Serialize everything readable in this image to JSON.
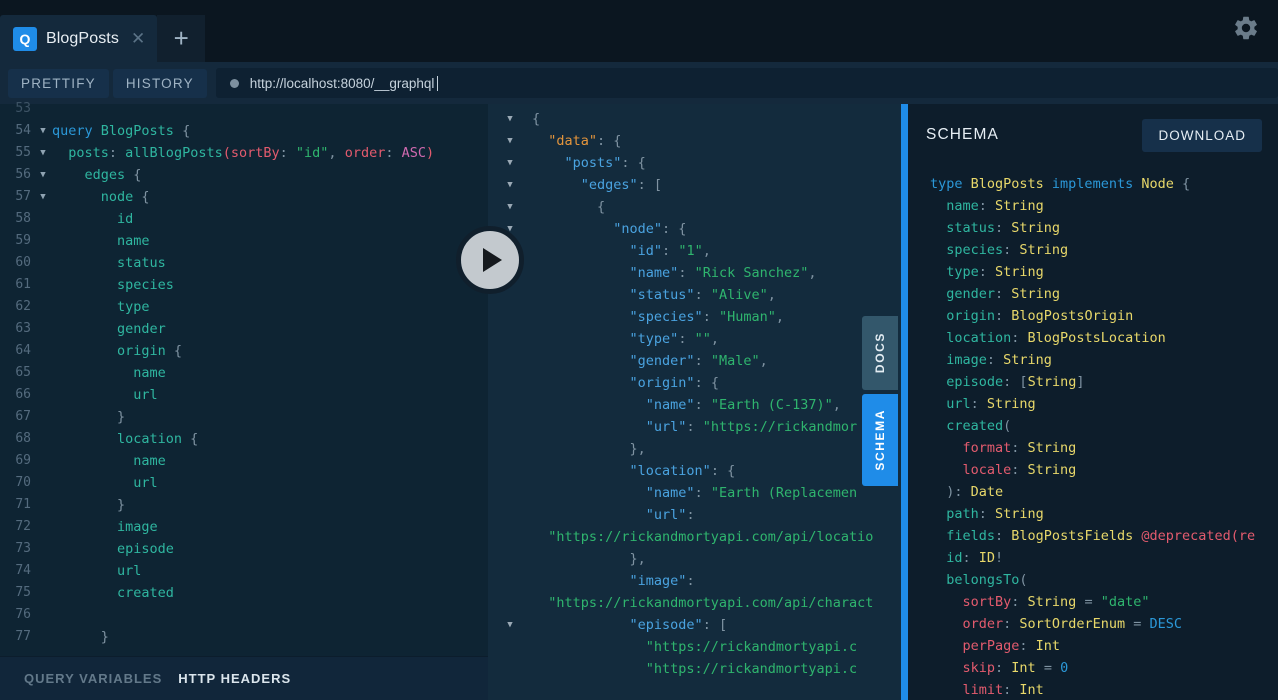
{
  "window": {
    "tab": {
      "badge": "Q",
      "title": "BlogPosts",
      "close_icon": "close-icon",
      "add_icon": "plus-icon"
    },
    "gear_icon": "gear-icon"
  },
  "toolbar": {
    "prettify": "PRETTIFY",
    "history": "HISTORY",
    "url": "http://localhost:8080/__graphql",
    "execute_icon": "play-icon"
  },
  "colors": {
    "accent_blue": "#1f8ce8",
    "editor_bg": "#0e2433",
    "response_bg": "#132b3d",
    "schema_bg": "#0d1d2b",
    "toolbar_bg": "#14293c"
  },
  "editor": {
    "first_partial_line": "53",
    "lines": [
      {
        "n": "54",
        "fold": true,
        "tokens": [
          {
            "t": "query ",
            "c": "c-kw"
          },
          {
            "t": "BlogPosts",
            "c": "c-key"
          },
          {
            "t": " {",
            "c": "c-punct"
          }
        ]
      },
      {
        "n": "55",
        "fold": true,
        "tokens": [
          {
            "t": "  posts",
            "c": "c-field"
          },
          {
            "t": ": ",
            "c": "c-punct"
          },
          {
            "t": "allBlogPosts",
            "c": "c-key"
          },
          {
            "t": "(",
            "c": "c-arg"
          },
          {
            "t": "sortBy",
            "c": "c-arg"
          },
          {
            "t": ": ",
            "c": "c-punct"
          },
          {
            "t": "\"id\"",
            "c": "c-str"
          },
          {
            "t": ", ",
            "c": "c-punct"
          },
          {
            "t": "order",
            "c": "c-arg"
          },
          {
            "t": ": ",
            "c": "c-punct"
          },
          {
            "t": "ASC",
            "c": "c-enum"
          },
          {
            "t": ")",
            "c": "c-arg"
          }
        ]
      },
      {
        "n": "56",
        "fold": true,
        "tokens": [
          {
            "t": "    edges",
            "c": "c-field"
          },
          {
            "t": " {",
            "c": "c-punct"
          }
        ]
      },
      {
        "n": "57",
        "fold": true,
        "tokens": [
          {
            "t": "      node",
            "c": "c-field"
          },
          {
            "t": " {",
            "c": "c-punct"
          }
        ]
      },
      {
        "n": "58",
        "fold": false,
        "tokens": [
          {
            "t": "        id",
            "c": "c-field"
          }
        ]
      },
      {
        "n": "59",
        "fold": false,
        "tokens": [
          {
            "t": "        name",
            "c": "c-field"
          }
        ]
      },
      {
        "n": "60",
        "fold": false,
        "tokens": [
          {
            "t": "        status",
            "c": "c-field"
          }
        ]
      },
      {
        "n": "61",
        "fold": false,
        "tokens": [
          {
            "t": "        species",
            "c": "c-field"
          }
        ]
      },
      {
        "n": "62",
        "fold": false,
        "tokens": [
          {
            "t": "        type",
            "c": "c-field"
          }
        ]
      },
      {
        "n": "63",
        "fold": false,
        "tokens": [
          {
            "t": "        gender",
            "c": "c-field"
          }
        ]
      },
      {
        "n": "64",
        "fold": false,
        "tokens": [
          {
            "t": "        origin",
            "c": "c-field"
          },
          {
            "t": " {",
            "c": "c-punct"
          }
        ]
      },
      {
        "n": "65",
        "fold": false,
        "tokens": [
          {
            "t": "          name",
            "c": "c-field"
          }
        ]
      },
      {
        "n": "66",
        "fold": false,
        "tokens": [
          {
            "t": "          url",
            "c": "c-field"
          }
        ]
      },
      {
        "n": "67",
        "fold": false,
        "tokens": [
          {
            "t": "        }",
            "c": "c-punct"
          }
        ]
      },
      {
        "n": "68",
        "fold": false,
        "tokens": [
          {
            "t": "        location",
            "c": "c-field"
          },
          {
            "t": " {",
            "c": "c-punct"
          }
        ]
      },
      {
        "n": "69",
        "fold": false,
        "tokens": [
          {
            "t": "          name",
            "c": "c-field"
          }
        ]
      },
      {
        "n": "70",
        "fold": false,
        "tokens": [
          {
            "t": "          url",
            "c": "c-field"
          }
        ]
      },
      {
        "n": "71",
        "fold": false,
        "tokens": [
          {
            "t": "        }",
            "c": "c-punct"
          }
        ]
      },
      {
        "n": "72",
        "fold": false,
        "tokens": [
          {
            "t": "        image",
            "c": "c-field"
          }
        ]
      },
      {
        "n": "73",
        "fold": false,
        "tokens": [
          {
            "t": "        episode",
            "c": "c-field"
          }
        ]
      },
      {
        "n": "74",
        "fold": false,
        "tokens": [
          {
            "t": "        url",
            "c": "c-field"
          }
        ]
      },
      {
        "n": "75",
        "fold": false,
        "tokens": [
          {
            "t": "        created",
            "c": "c-field"
          }
        ]
      },
      {
        "n": "76",
        "fold": false,
        "tokens": [
          {
            "t": "",
            "c": "c-punct"
          }
        ]
      },
      {
        "n": "77",
        "fold": false,
        "tokens": [
          {
            "t": "      }",
            "c": "c-punct"
          }
        ]
      }
    ]
  },
  "bottom_tabs": {
    "query_variables": "QUERY VARIABLES",
    "http_headers": "HTTP HEADERS",
    "active": "HTTP HEADERS"
  },
  "response": {
    "lines": [
      {
        "fold": true,
        "tokens": [
          {
            "t": "{",
            "c": "c-punct"
          }
        ]
      },
      {
        "fold": true,
        "tokens": [
          {
            "t": "  \"data\"",
            "c": "c-jdata"
          },
          {
            "t": ": {",
            "c": "c-punct"
          }
        ]
      },
      {
        "fold": true,
        "tokens": [
          {
            "t": "    \"posts\"",
            "c": "c-jkey"
          },
          {
            "t": ": {",
            "c": "c-punct"
          }
        ]
      },
      {
        "fold": true,
        "tokens": [
          {
            "t": "      \"edges\"",
            "c": "c-jkey"
          },
          {
            "t": ": [",
            "c": "c-punct"
          }
        ]
      },
      {
        "fold": true,
        "tokens": [
          {
            "t": "        {",
            "c": "c-punct"
          }
        ]
      },
      {
        "fold": true,
        "tokens": [
          {
            "t": "          \"node\"",
            "c": "c-jkey"
          },
          {
            "t": ": {",
            "c": "c-punct"
          }
        ]
      },
      {
        "fold": false,
        "tokens": [
          {
            "t": "            \"id\"",
            "c": "c-jkey"
          },
          {
            "t": ": ",
            "c": "c-punct"
          },
          {
            "t": "\"1\"",
            "c": "c-jstr"
          },
          {
            "t": ",",
            "c": "c-punct"
          }
        ]
      },
      {
        "fold": false,
        "tokens": [
          {
            "t": "            \"name\"",
            "c": "c-jkey"
          },
          {
            "t": ": ",
            "c": "c-punct"
          },
          {
            "t": "\"Rick Sanchez\"",
            "c": "c-jstr"
          },
          {
            "t": ",",
            "c": "c-punct"
          }
        ]
      },
      {
        "fold": false,
        "tokens": [
          {
            "t": "            \"status\"",
            "c": "c-jkey"
          },
          {
            "t": ": ",
            "c": "c-punct"
          },
          {
            "t": "\"Alive\"",
            "c": "c-jstr"
          },
          {
            "t": ",",
            "c": "c-punct"
          }
        ]
      },
      {
        "fold": false,
        "tokens": [
          {
            "t": "            \"species\"",
            "c": "c-jkey"
          },
          {
            "t": ": ",
            "c": "c-punct"
          },
          {
            "t": "\"Human\"",
            "c": "c-jstr"
          },
          {
            "t": ",",
            "c": "c-punct"
          }
        ]
      },
      {
        "fold": false,
        "tokens": [
          {
            "t": "            \"type\"",
            "c": "c-jkey"
          },
          {
            "t": ": ",
            "c": "c-punct"
          },
          {
            "t": "\"\"",
            "c": "c-jstr"
          },
          {
            "t": ",",
            "c": "c-punct"
          }
        ]
      },
      {
        "fold": false,
        "tokens": [
          {
            "t": "            \"gender\"",
            "c": "c-jkey"
          },
          {
            "t": ": ",
            "c": "c-punct"
          },
          {
            "t": "\"Male\"",
            "c": "c-jstr"
          },
          {
            "t": ",",
            "c": "c-punct"
          }
        ]
      },
      {
        "fold": false,
        "tokens": [
          {
            "t": "            \"origin\"",
            "c": "c-jkey"
          },
          {
            "t": ": {",
            "c": "c-punct"
          }
        ]
      },
      {
        "fold": false,
        "tokens": [
          {
            "t": "              \"name\"",
            "c": "c-jkey"
          },
          {
            "t": ": ",
            "c": "c-punct"
          },
          {
            "t": "\"Earth (C-137)\"",
            "c": "c-jstr"
          },
          {
            "t": ",",
            "c": "c-punct"
          }
        ]
      },
      {
        "fold": false,
        "tokens": [
          {
            "t": "              \"url\"",
            "c": "c-jkey"
          },
          {
            "t": ": ",
            "c": "c-punct"
          },
          {
            "t": "\"https://rickandmor",
            "c": "c-jstr"
          }
        ]
      },
      {
        "fold": false,
        "tokens": [
          {
            "t": "            },",
            "c": "c-punct"
          }
        ]
      },
      {
        "fold": false,
        "tokens": [
          {
            "t": "            \"location\"",
            "c": "c-jkey"
          },
          {
            "t": ": {",
            "c": "c-punct"
          }
        ]
      },
      {
        "fold": false,
        "tokens": [
          {
            "t": "              \"name\"",
            "c": "c-jkey"
          },
          {
            "t": ": ",
            "c": "c-punct"
          },
          {
            "t": "\"Earth (Replacemen",
            "c": "c-jstr"
          }
        ]
      },
      {
        "fold": false,
        "tokens": [
          {
            "t": "              \"url\"",
            "c": "c-jkey"
          },
          {
            "t": ":",
            "c": "c-punct"
          }
        ]
      },
      {
        "fold": false,
        "tokens": [
          {
            "t": "  \"https://rickandmortyapi.com/api/locatio",
            "c": "c-jstr"
          }
        ]
      },
      {
        "fold": false,
        "tokens": [
          {
            "t": "            },",
            "c": "c-punct"
          }
        ]
      },
      {
        "fold": false,
        "tokens": [
          {
            "t": "            \"image\"",
            "c": "c-jkey"
          },
          {
            "t": ":",
            "c": "c-punct"
          }
        ]
      },
      {
        "fold": false,
        "tokens": [
          {
            "t": "  \"https://rickandmortyapi.com/api/charact",
            "c": "c-jstr"
          }
        ]
      },
      {
        "fold": true,
        "tokens": [
          {
            "t": "            \"episode\"",
            "c": "c-jkey"
          },
          {
            "t": ": [",
            "c": "c-punct"
          }
        ]
      },
      {
        "fold": false,
        "tokens": [
          {
            "t": "              \"https://rickandmortyapi.c",
            "c": "c-jstr"
          }
        ]
      },
      {
        "fold": false,
        "tokens": [
          {
            "t": "              \"https://rickandmortyapi.c",
            "c": "c-jstr"
          }
        ]
      }
    ]
  },
  "side_tabs": {
    "docs": "DOCS",
    "schema": "SCHEMA",
    "active": "SCHEMA"
  },
  "schema": {
    "title": "SCHEMA",
    "download": "DOWNLOAD",
    "lines": [
      [
        {
          "t": "type ",
          "c": "c-blue"
        },
        {
          "t": "BlogPosts",
          "c": "c-type"
        },
        {
          "t": " implements ",
          "c": "c-blue"
        },
        {
          "t": "Node",
          "c": "c-type"
        },
        {
          "t": " {",
          "c": "c-punct"
        }
      ],
      [
        {
          "t": "  name",
          "c": "c-field"
        },
        {
          "t": ": ",
          "c": "c-punct"
        },
        {
          "t": "String",
          "c": "c-type"
        }
      ],
      [
        {
          "t": "  status",
          "c": "c-field"
        },
        {
          "t": ": ",
          "c": "c-punct"
        },
        {
          "t": "String",
          "c": "c-type"
        }
      ],
      [
        {
          "t": "  species",
          "c": "c-field"
        },
        {
          "t": ": ",
          "c": "c-punct"
        },
        {
          "t": "String",
          "c": "c-type"
        }
      ],
      [
        {
          "t": "  type",
          "c": "c-field"
        },
        {
          "t": ": ",
          "c": "c-punct"
        },
        {
          "t": "String",
          "c": "c-type"
        }
      ],
      [
        {
          "t": "  gender",
          "c": "c-field"
        },
        {
          "t": ": ",
          "c": "c-punct"
        },
        {
          "t": "String",
          "c": "c-type"
        }
      ],
      [
        {
          "t": "  origin",
          "c": "c-field"
        },
        {
          "t": ": ",
          "c": "c-punct"
        },
        {
          "t": "BlogPostsOrigin",
          "c": "c-type"
        }
      ],
      [
        {
          "t": "  location",
          "c": "c-field"
        },
        {
          "t": ": ",
          "c": "c-punct"
        },
        {
          "t": "BlogPostsLocation",
          "c": "c-type"
        }
      ],
      [
        {
          "t": "  image",
          "c": "c-field"
        },
        {
          "t": ": ",
          "c": "c-punct"
        },
        {
          "t": "String",
          "c": "c-type"
        }
      ],
      [
        {
          "t": "  episode",
          "c": "c-field"
        },
        {
          "t": ": ",
          "c": "c-punct"
        },
        {
          "t": "[",
          "c": "c-punct"
        },
        {
          "t": "String",
          "c": "c-type"
        },
        {
          "t": "]",
          "c": "c-punct"
        }
      ],
      [
        {
          "t": "  url",
          "c": "c-field"
        },
        {
          "t": ": ",
          "c": "c-punct"
        },
        {
          "t": "String",
          "c": "c-type"
        }
      ],
      [
        {
          "t": "  created",
          "c": "c-field"
        },
        {
          "t": "(",
          "c": "c-punct"
        }
      ],
      [
        {
          "t": "    format",
          "c": "c-dep"
        },
        {
          "t": ": ",
          "c": "c-punct"
        },
        {
          "t": "String",
          "c": "c-type"
        }
      ],
      [
        {
          "t": "    locale",
          "c": "c-dep"
        },
        {
          "t": ": ",
          "c": "c-punct"
        },
        {
          "t": "String",
          "c": "c-type"
        }
      ],
      [
        {
          "t": "  )",
          "c": "c-punct"
        },
        {
          "t": ": ",
          "c": "c-punct"
        },
        {
          "t": "Date",
          "c": "c-type"
        }
      ],
      [
        {
          "t": "  path",
          "c": "c-field"
        },
        {
          "t": ": ",
          "c": "c-punct"
        },
        {
          "t": "String",
          "c": "c-type"
        }
      ],
      [
        {
          "t": "  fields",
          "c": "c-field"
        },
        {
          "t": ": ",
          "c": "c-punct"
        },
        {
          "t": "BlogPostsFields",
          "c": "c-type"
        },
        {
          "t": " @deprecated(re",
          "c": "c-dep"
        }
      ],
      [
        {
          "t": "  id",
          "c": "c-field"
        },
        {
          "t": ": ",
          "c": "c-punct"
        },
        {
          "t": "ID",
          "c": "c-type"
        },
        {
          "t": "!",
          "c": "c-punct"
        }
      ],
      [
        {
          "t": "  belongsTo",
          "c": "c-field"
        },
        {
          "t": "(",
          "c": "c-punct"
        }
      ],
      [
        {
          "t": "    sortBy",
          "c": "c-dep"
        },
        {
          "t": ": ",
          "c": "c-punct"
        },
        {
          "t": "String",
          "c": "c-type"
        },
        {
          "t": " = ",
          "c": "c-punct"
        },
        {
          "t": "\"date\"",
          "c": "c-jstr"
        }
      ],
      [
        {
          "t": "    order",
          "c": "c-dep"
        },
        {
          "t": ": ",
          "c": "c-punct"
        },
        {
          "t": "SortOrderEnum",
          "c": "c-type"
        },
        {
          "t": " = ",
          "c": "c-punct"
        },
        {
          "t": "DESC",
          "c": "c-blue"
        }
      ],
      [
        {
          "t": "    perPage",
          "c": "c-dep"
        },
        {
          "t": ": ",
          "c": "c-punct"
        },
        {
          "t": "Int",
          "c": "c-type"
        }
      ],
      [
        {
          "t": "    skip",
          "c": "c-dep"
        },
        {
          "t": ": ",
          "c": "c-punct"
        },
        {
          "t": "Int",
          "c": "c-type"
        },
        {
          "t": " = ",
          "c": "c-punct"
        },
        {
          "t": "0",
          "c": "c-blue"
        }
      ],
      [
        {
          "t": "    limit",
          "c": "c-dep"
        },
        {
          "t": ": ",
          "c": "c-punct"
        },
        {
          "t": "Int",
          "c": "c-type"
        }
      ]
    ]
  }
}
